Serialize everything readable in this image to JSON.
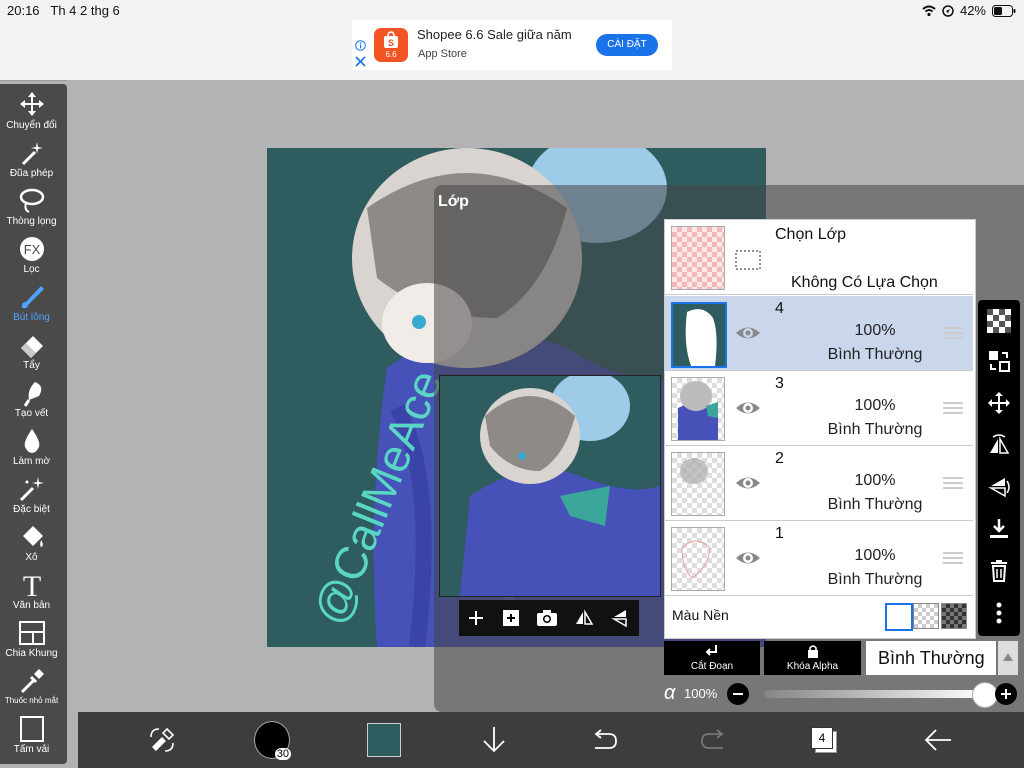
{
  "status": {
    "time": "20:16",
    "date": "Th 4 2 thg 6",
    "battery": "42%"
  },
  "ad": {
    "title": "Shopee 6.6 Sale giữa năm",
    "store": "App Store",
    "install": "CÀI ĐẶT",
    "logo_text": "6.6"
  },
  "tools": [
    {
      "label": "Chuyển đổi",
      "icon": "move-icon"
    },
    {
      "label": "Đũa phép",
      "icon": "magic-wand-icon"
    },
    {
      "label": "Thòng lọng",
      "icon": "lasso-icon"
    },
    {
      "label": "Lọc",
      "icon": "fx-icon"
    },
    {
      "label": "Bút lông",
      "icon": "brush-icon"
    },
    {
      "label": "Tẩy",
      "icon": "eraser-icon"
    },
    {
      "label": "Tạo vết",
      "icon": "smudge-icon"
    },
    {
      "label": "Làm mờ",
      "icon": "blur-icon"
    },
    {
      "label": "Đặc biệt",
      "icon": "special-icon"
    },
    {
      "label": "Xô",
      "icon": "bucket-icon"
    },
    {
      "label": "Văn bản",
      "icon": "text-icon"
    },
    {
      "label": "Chia Khung",
      "icon": "frame-divider-icon"
    },
    {
      "label": "Thuốc nhỏ mắt",
      "icon": "eyedropper-icon"
    },
    {
      "label": "Tấm vải",
      "icon": "canvas-icon"
    }
  ],
  "active_tool": "Bút lông",
  "layer_panel": {
    "title": "Lớp",
    "selection_row": {
      "title": "Chọn Lớp",
      "subtitle": "Không Có Lựa Chọn"
    },
    "layers": [
      {
        "number": "4",
        "opacity": "100%",
        "blend": "Bình Thường",
        "selected": true
      },
      {
        "number": "3",
        "opacity": "100%",
        "blend": "Bình Thường",
        "selected": false
      },
      {
        "number": "2",
        "opacity": "100%",
        "blend": "Bình Thường",
        "selected": false
      },
      {
        "number": "1",
        "opacity": "100%",
        "blend": "Bình Thường",
        "selected": false
      }
    ],
    "background_label": "Màu Nền",
    "clipping_label": "Cắt Đoạn",
    "alpha_lock_label": "Khóa Alpha",
    "blend_mode": "Bình Thường",
    "alpha_symbol": "α",
    "alpha_value": "100%",
    "alpha_level": 1.0
  },
  "artwork_text": "@CallMeAce",
  "bottom": {
    "brush_size": "30",
    "layer_count": "4",
    "color": "#2e5c5f"
  }
}
